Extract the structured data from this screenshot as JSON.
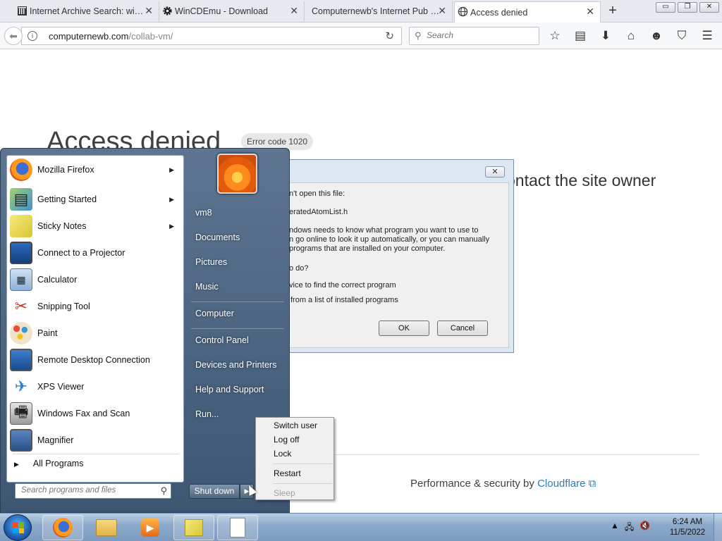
{
  "browser": {
    "tabs": [
      {
        "label": "Internet Archive Search: wi…",
        "icon": "archive-icon",
        "active": false
      },
      {
        "label": "WinCDEmu - Download",
        "icon": "gear-icon",
        "active": false
      },
      {
        "label": "Computernewb's Internet Pub …",
        "icon": "",
        "active": false
      },
      {
        "label": "Access denied",
        "icon": "globe-icon",
        "active": true
      }
    ],
    "new_tab": "+",
    "window_buttons": {
      "minimize": "▭",
      "restore": "❐",
      "close": "✕"
    },
    "url_domain": "computernewb.com",
    "url_path": "/collab-vm/",
    "search_placeholder": "Search",
    "nav_icons": [
      "star-icon",
      "reader-icon",
      "download-icon",
      "home-icon",
      "smiley-icon",
      "pocket-icon",
      "menu-icon"
    ]
  },
  "page": {
    "title": "Access denied",
    "error_badge": "Error code 1020",
    "subtitle": "ontact the site owner",
    "footer_prefix": "Performance & security by ",
    "footer_link": "Cloudflare"
  },
  "dialog": {
    "close": "✕",
    "lines": [
      "n't open this file:",
      "eratedAtomList.h",
      "ndows needs to know what program you want to use to",
      "n go online to look it up automatically, or you can manually",
      "programs that are installed on your computer.",
      "o do?",
      "vice to find the correct program",
      "from a list of installed programs"
    ],
    "ok": "OK",
    "cancel": "Cancel"
  },
  "start_menu": {
    "programs": [
      {
        "label": "Mozilla Firefox",
        "icon": "firefox-icon",
        "arrow": true
      },
      {
        "label": "Getting Started",
        "icon": "getting-started-icon",
        "arrow": true
      },
      {
        "label": "Sticky Notes",
        "icon": "sticky-notes-icon",
        "arrow": true
      },
      {
        "label": "Connect to a Projector",
        "icon": "projector-icon",
        "arrow": false
      },
      {
        "label": "Calculator",
        "icon": "calculator-icon",
        "arrow": false
      },
      {
        "label": "Snipping Tool",
        "icon": "scissors-icon",
        "arrow": false
      },
      {
        "label": "Paint",
        "icon": "paint-icon",
        "arrow": false
      },
      {
        "label": "Remote Desktop Connection",
        "icon": "remote-desktop-icon",
        "arrow": false
      },
      {
        "label": "XPS Viewer",
        "icon": "xps-viewer-icon",
        "arrow": false
      },
      {
        "label": "Windows Fax and Scan",
        "icon": "fax-icon",
        "arrow": false
      },
      {
        "label": "Magnifier",
        "icon": "magnifier-icon",
        "arrow": false
      }
    ],
    "all_programs": "All Programs",
    "search_placeholder": "Search programs and files",
    "right_links": [
      "vm8",
      "Documents",
      "Pictures",
      "Music",
      "Computer",
      "Control Panel",
      "Devices and Printers",
      "Help and Support",
      "Run..."
    ],
    "shutdown": "Shut down"
  },
  "context_menu": {
    "items": [
      "Switch user",
      "Log off",
      "Lock",
      "Restart",
      "Sleep"
    ]
  },
  "taskbar": {
    "time": "6:24 AM",
    "date": "11/5/2022"
  }
}
